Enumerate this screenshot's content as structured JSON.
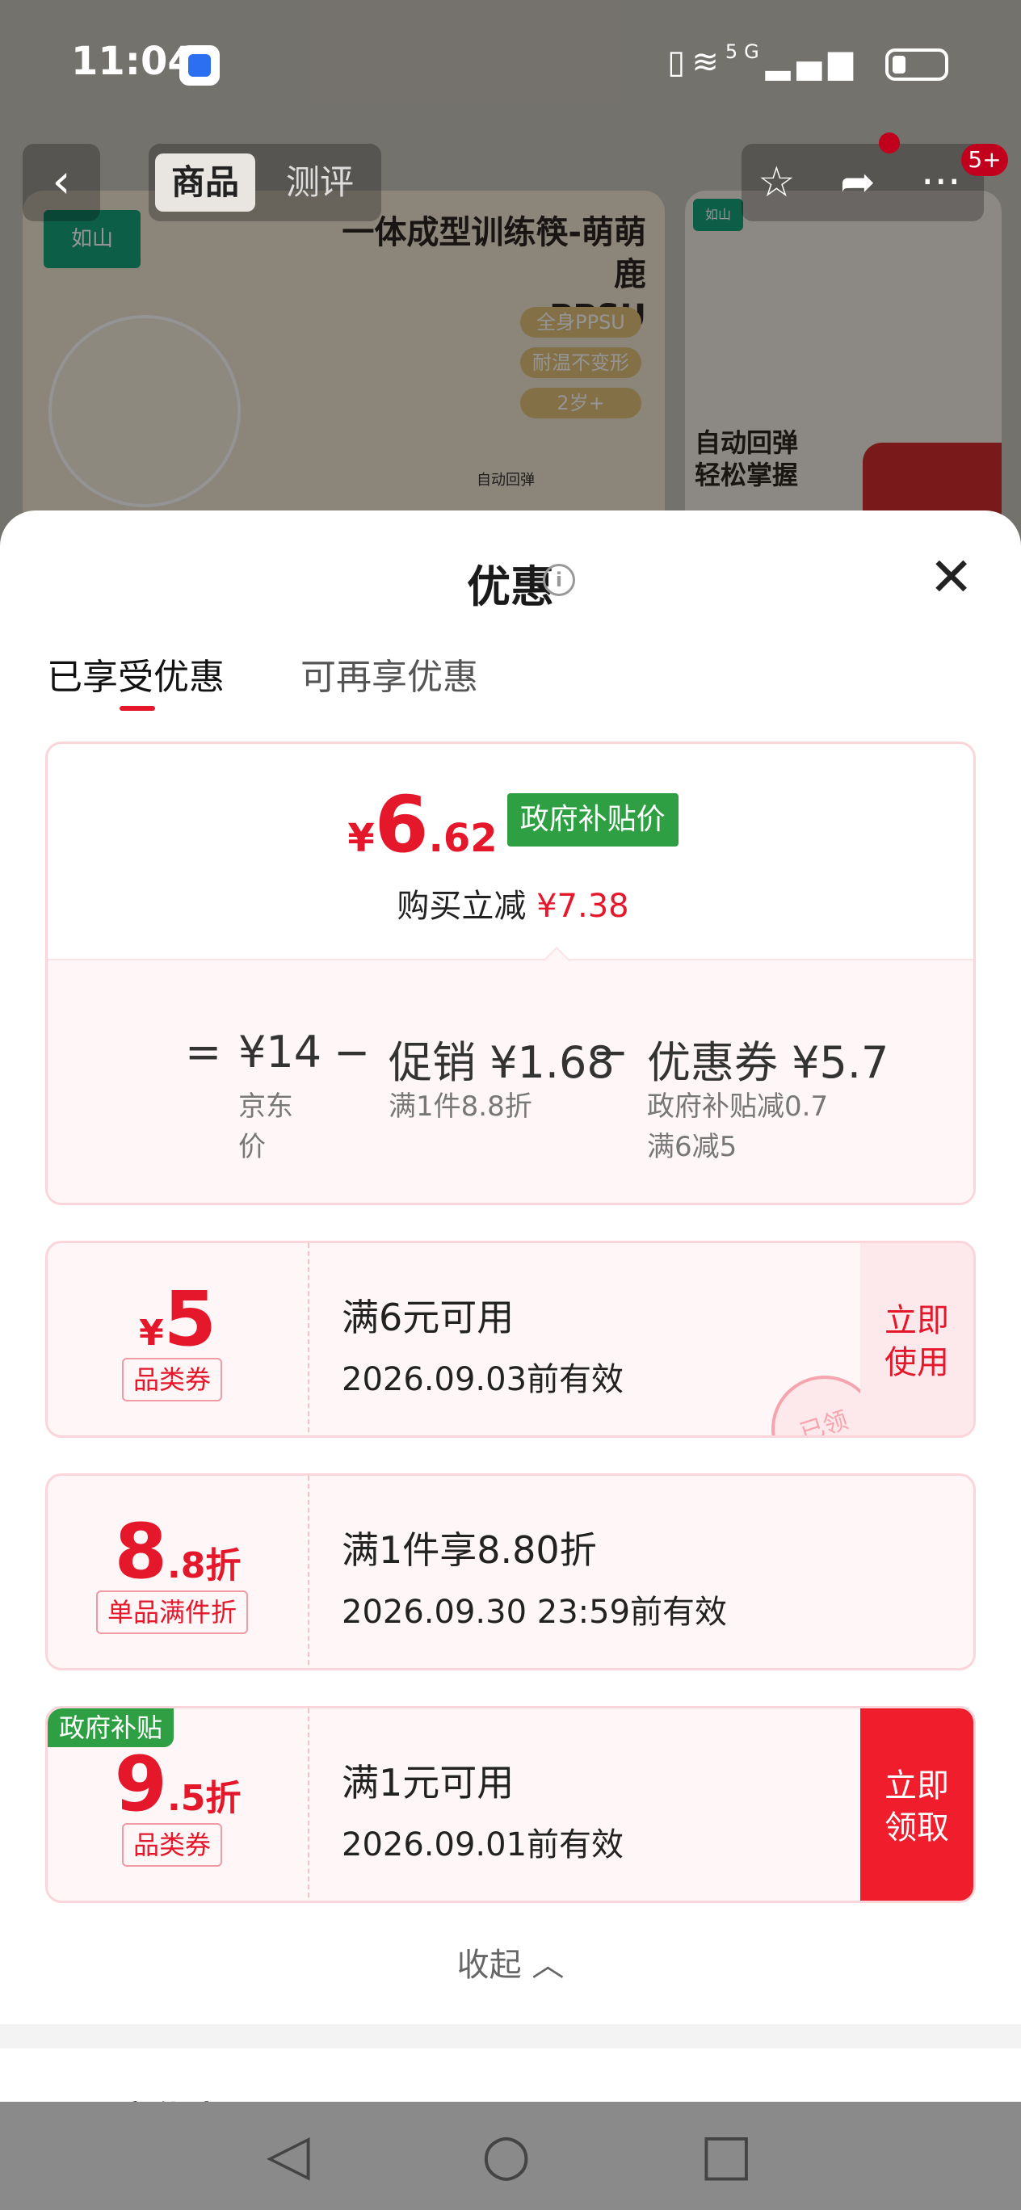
{
  "status_bar": {
    "time": "11:04",
    "network": "5G"
  },
  "product_page": {
    "tabs": [
      "商品",
      "测评"
    ],
    "badge": "5+",
    "title_line1": "一体成型训练筷-萌萌鹿",
    "title_line2": "PPSU",
    "chips": [
      "全身PPSU",
      "耐温不变形",
      "2岁+"
    ],
    "side_text_line1": "自动回弹",
    "side_text_line2": "轻松掌握",
    "logo_text": "如山",
    "caption": "自动回弹"
  },
  "sheet": {
    "title": "优惠",
    "close_label": "✕",
    "tabs": {
      "enjoyed": "已享受优惠",
      "more": "可再享优惠"
    },
    "summary": {
      "price_symbol": "¥",
      "price_int": "6",
      "price_dec": ".62",
      "price_tag": "政府补贴价",
      "reduce_label": "购买立减",
      "reduce_amount": "¥7.38",
      "equals": "=",
      "minus": "−",
      "jd_price": "¥14",
      "jd_label_line1": "京东",
      "jd_label_line2": "价",
      "promo_label": "促销 ¥1.68",
      "promo_sub": "满1件8.8折",
      "coupon_label": "优惠券 ¥5.7",
      "coupon_sub1": "政府补贴减0.7",
      "coupon_sub2": "满6减5"
    },
    "coupons": [
      {
        "value_prefix": "¥",
        "value_main": "5",
        "value_suffix": "",
        "tag": "品类券",
        "condition": "满6元可用",
        "validity": "2026.09.03前有效",
        "action_line1": "立即",
        "action_line2": "使用",
        "stamp": "已领"
      },
      {
        "value_prefix": "",
        "value_main": "8",
        "value_suffix": ".8折",
        "tag": "单品满件折",
        "condition": "满1件享8.80折",
        "validity": "2026.09.30 23:59前有效"
      },
      {
        "corner_tag": "政府补贴",
        "value_prefix": "",
        "value_main": "9",
        "value_suffix": ".5折",
        "tag": "品类券",
        "condition": "满1元可用",
        "validity": "2026.09.01前有效",
        "action_line1": "立即",
        "action_line2": "领取"
      }
    ],
    "collapse_label": "收起 ︿",
    "next_section_title": "可再享优惠"
  },
  "colors": {
    "accent_red": "#e5172a",
    "gov_green": "#2ea043"
  }
}
